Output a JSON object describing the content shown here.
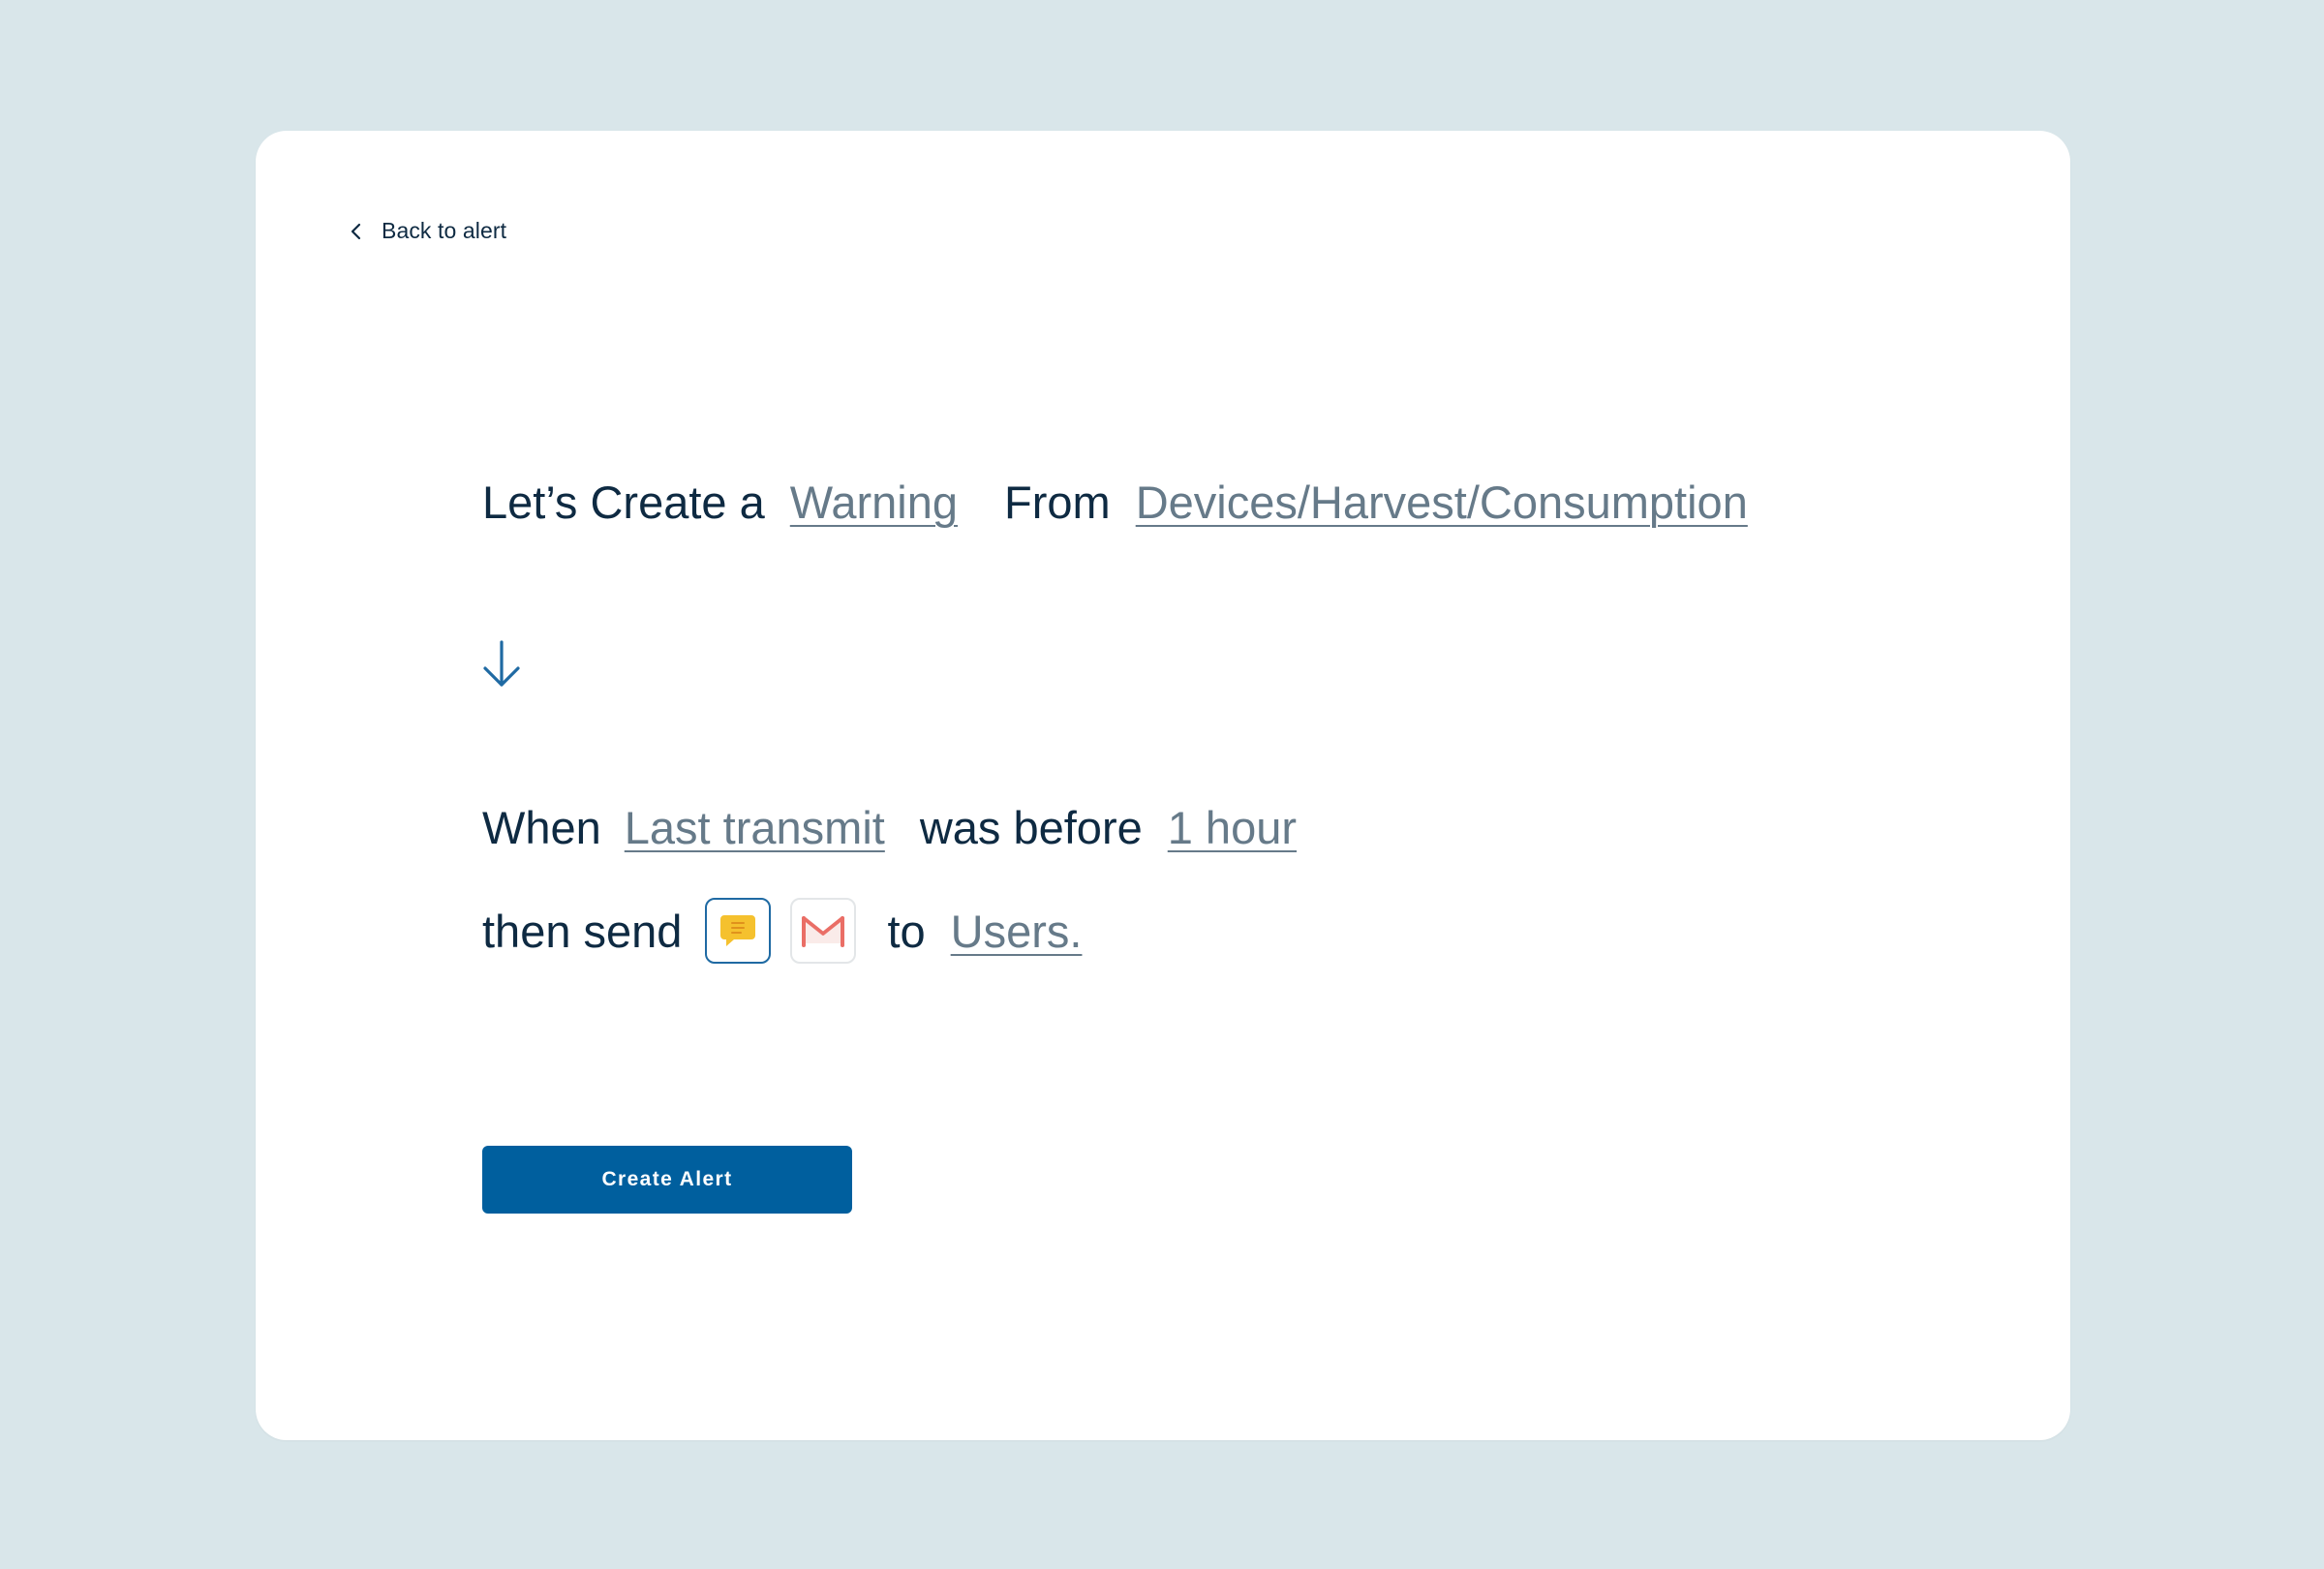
{
  "nav": {
    "back_label": "Back to alert"
  },
  "rule": {
    "intro": "Let’s Create a",
    "alert_type": "Warning",
    "from_label": "From",
    "source": "Devices/Harvest/Consumption",
    "when_label": "When",
    "condition_field": "Last transmit",
    "operator": "was before",
    "threshold": "1 hour",
    "then_label": "then send",
    "to_label": "to",
    "recipients": "Users."
  },
  "channels": [
    {
      "icon": "chat-message-icon",
      "selected": true
    },
    {
      "icon": "gmail-icon",
      "selected": false
    }
  ],
  "actions": {
    "create_label": "Create Alert"
  },
  "colors": {
    "background": "#d9e6ea",
    "card": "#ffffff",
    "text": "#0e2a42",
    "token": "#667a89",
    "primary": "#005f9e",
    "selected_border": "#1f6aa3",
    "chat_icon": "#f5c12e",
    "gmail_icon": "#ea6e66"
  }
}
